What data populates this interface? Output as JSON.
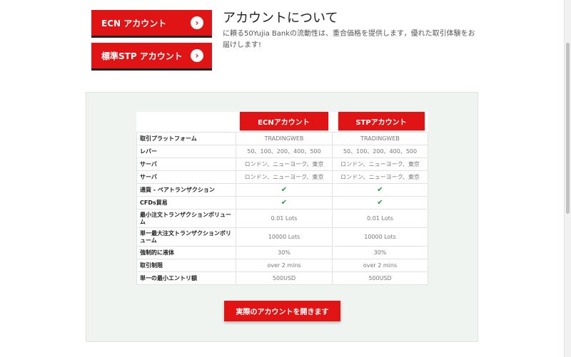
{
  "account_buttons": {
    "ecn_label": "ECN アカウント",
    "stp_label": "標準STP アカウント",
    "chevron": "›"
  },
  "about": {
    "title": "アカウントについて",
    "description": "に頼る50Yujia Bankの流動性は、重合価格を提供します，優れた取引体験をお届けします!"
  },
  "table": {
    "columns": [
      "ECNアカウント",
      "STPアカウント"
    ],
    "rows": [
      {
        "label": "取引プラットフォーム",
        "ecn": "TRADINGWEB",
        "stp": "TRADINGWEB"
      },
      {
        "label": "レバー",
        "ecn": "50、100、200、400、500",
        "stp": "50、100、200、400、500"
      },
      {
        "label": "サーバ",
        "ecn": "ロンドン、ニューヨーク、東京",
        "stp": "ロンドン、ニューヨーク、東京"
      },
      {
        "label": "サーバ",
        "ecn": "ロンドン、ニューヨーク、東京",
        "stp": "ロンドン、ニューヨーク、東京"
      },
      {
        "label": "通貨 - ペアトランザクション",
        "ecn": "✔",
        "stp": "✔"
      },
      {
        "label": "CFDs貿易",
        "ecn": "✔",
        "stp": "✔"
      },
      {
        "label": "最小注文トランザクションボリューム",
        "ecn": "0.01 Lots",
        "stp": "0.01 Lots"
      },
      {
        "label": "単一最大注文トランザクションボリューム",
        "ecn": "10000 Lots",
        "stp": "10000 Lots"
      },
      {
        "label": "強制的に液体",
        "ecn": "30%",
        "stp": "30%"
      },
      {
        "label": "取引制限",
        "ecn": "over 2 mins",
        "stp": "over 2 mins"
      },
      {
        "label": "単一の最小エントリ額",
        "ecn": "500USD",
        "stp": "500USD"
      }
    ]
  },
  "cta": {
    "open_account_label": "実際のアカウントを開きます"
  },
  "colors": {
    "accent": "#e01414",
    "check": "#1f9e3b",
    "panel_bg": "#f0f4f0"
  }
}
